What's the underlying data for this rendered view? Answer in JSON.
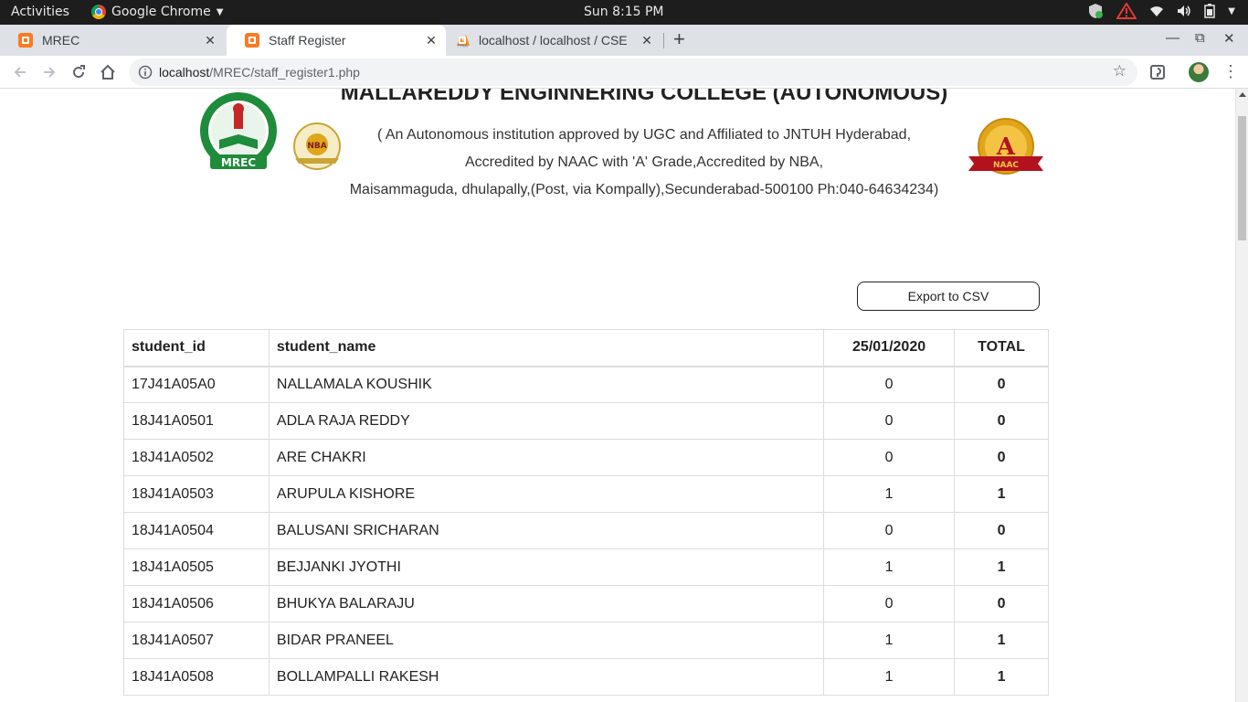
{
  "system_bar": {
    "activities": "Activities",
    "app_name": "Google Chrome",
    "clock": "Sun  8:15 PM"
  },
  "tabs": [
    {
      "title": "MREC",
      "active": false
    },
    {
      "title": "Staff Register",
      "active": true
    },
    {
      "title": "localhost / localhost / CSE",
      "active": false
    }
  ],
  "address_bar": {
    "host": "localhost",
    "path": "/MREC/staff_register1.php"
  },
  "header": {
    "college_name": "MALLAREDDY ENGINNERING COLLEGE (AUTONOMOUS)",
    "line1": "( An Autonomous institution approved by UGC and Affiliated to JNTUH Hyderabad,",
    "line2": "Accredited by NAAC with 'A' Grade,Accredited by NBA,",
    "line3": "Maisammaguda, dhulapally,(Post, via Kompally),Secunderabad-500100 Ph:040-64634234)",
    "logo_mrec_text": "MREC",
    "logo_nba_text": "NBA",
    "logo_naac_grade": "A",
    "logo_naac_text": "NAAC"
  },
  "export_label": "Export to CSV",
  "table": {
    "columns": [
      "student_id",
      "student_name",
      "25/01/2020",
      "TOTAL"
    ],
    "rows": [
      [
        "17J41A05A0",
        "NALLAMALA KOUSHIK",
        "0",
        "0"
      ],
      [
        "18J41A0501",
        "ADLA RAJA REDDY",
        "0",
        "0"
      ],
      [
        "18J41A0502",
        "ARE CHAKRI",
        "0",
        "0"
      ],
      [
        "18J41A0503",
        "ARUPULA KISHORE",
        "1",
        "1"
      ],
      [
        "18J41A0504",
        "BALUSANI SRICHARAN",
        "0",
        "0"
      ],
      [
        "18J41A0505",
        "BEJJANKI JYOTHI",
        "1",
        "1"
      ],
      [
        "18J41A0506",
        "BHUKYA BALARAJU",
        "0",
        "0"
      ],
      [
        "18J41A0507",
        "BIDAR PRANEEL",
        "1",
        "1"
      ],
      [
        "18J41A0508",
        "BOLLAMPALLI RAKESH",
        "1",
        "1"
      ]
    ]
  },
  "colors": {
    "mrec_green": "#1e8c3a",
    "naac_gold": "#e0a51a",
    "naac_red": "#b3121c",
    "tab_favicon": "#fb7a24"
  }
}
